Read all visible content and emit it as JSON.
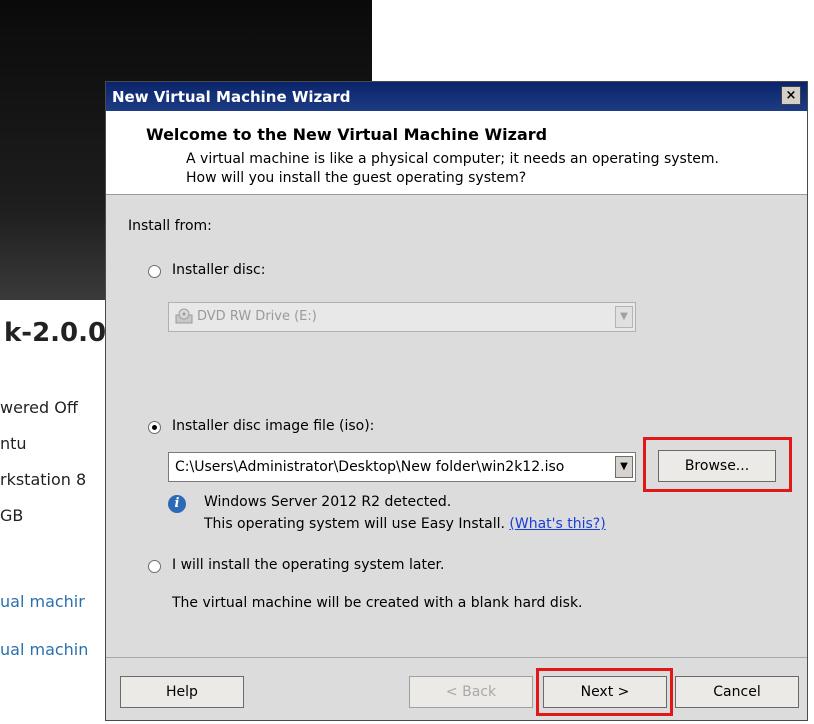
{
  "background": {
    "title": "k-2.0.0",
    "info_lines": [
      "wered Off",
      "ntu",
      "rkstation 8",
      "GB"
    ],
    "links": [
      "ual machir",
      "ual machin"
    ]
  },
  "dialog": {
    "window_title": "New Virtual Machine Wizard",
    "close_label": "×",
    "header": {
      "title": "Welcome to the New Virtual Machine Wizard",
      "description": "A virtual machine is like a physical computer; it needs an operating system. How will you install the guest operating system?"
    },
    "install_from_label": "Install from:",
    "options": {
      "installer_disc": {
        "label": "Installer disc:",
        "selected": false,
        "drive_value": "DVD RW Drive (E:)"
      },
      "iso": {
        "label": "Installer disc image file (iso):",
        "selected": true,
        "path_value": "C:\\Users\\Administrator\\Desktop\\New folder\\win2k12.iso",
        "detected_text": "Windows Server 2012 R2 detected.",
        "easy_install_text": "This operating system will use Easy Install.",
        "whats_this_link": "(What's this?)"
      },
      "later": {
        "label": "I will install the operating system later.",
        "selected": false,
        "description": "The virtual machine will be created with a blank hard disk."
      }
    },
    "buttons": {
      "browse": "Browse...",
      "help": "Help",
      "back": "< Back",
      "next": "Next >",
      "cancel": "Cancel"
    }
  }
}
